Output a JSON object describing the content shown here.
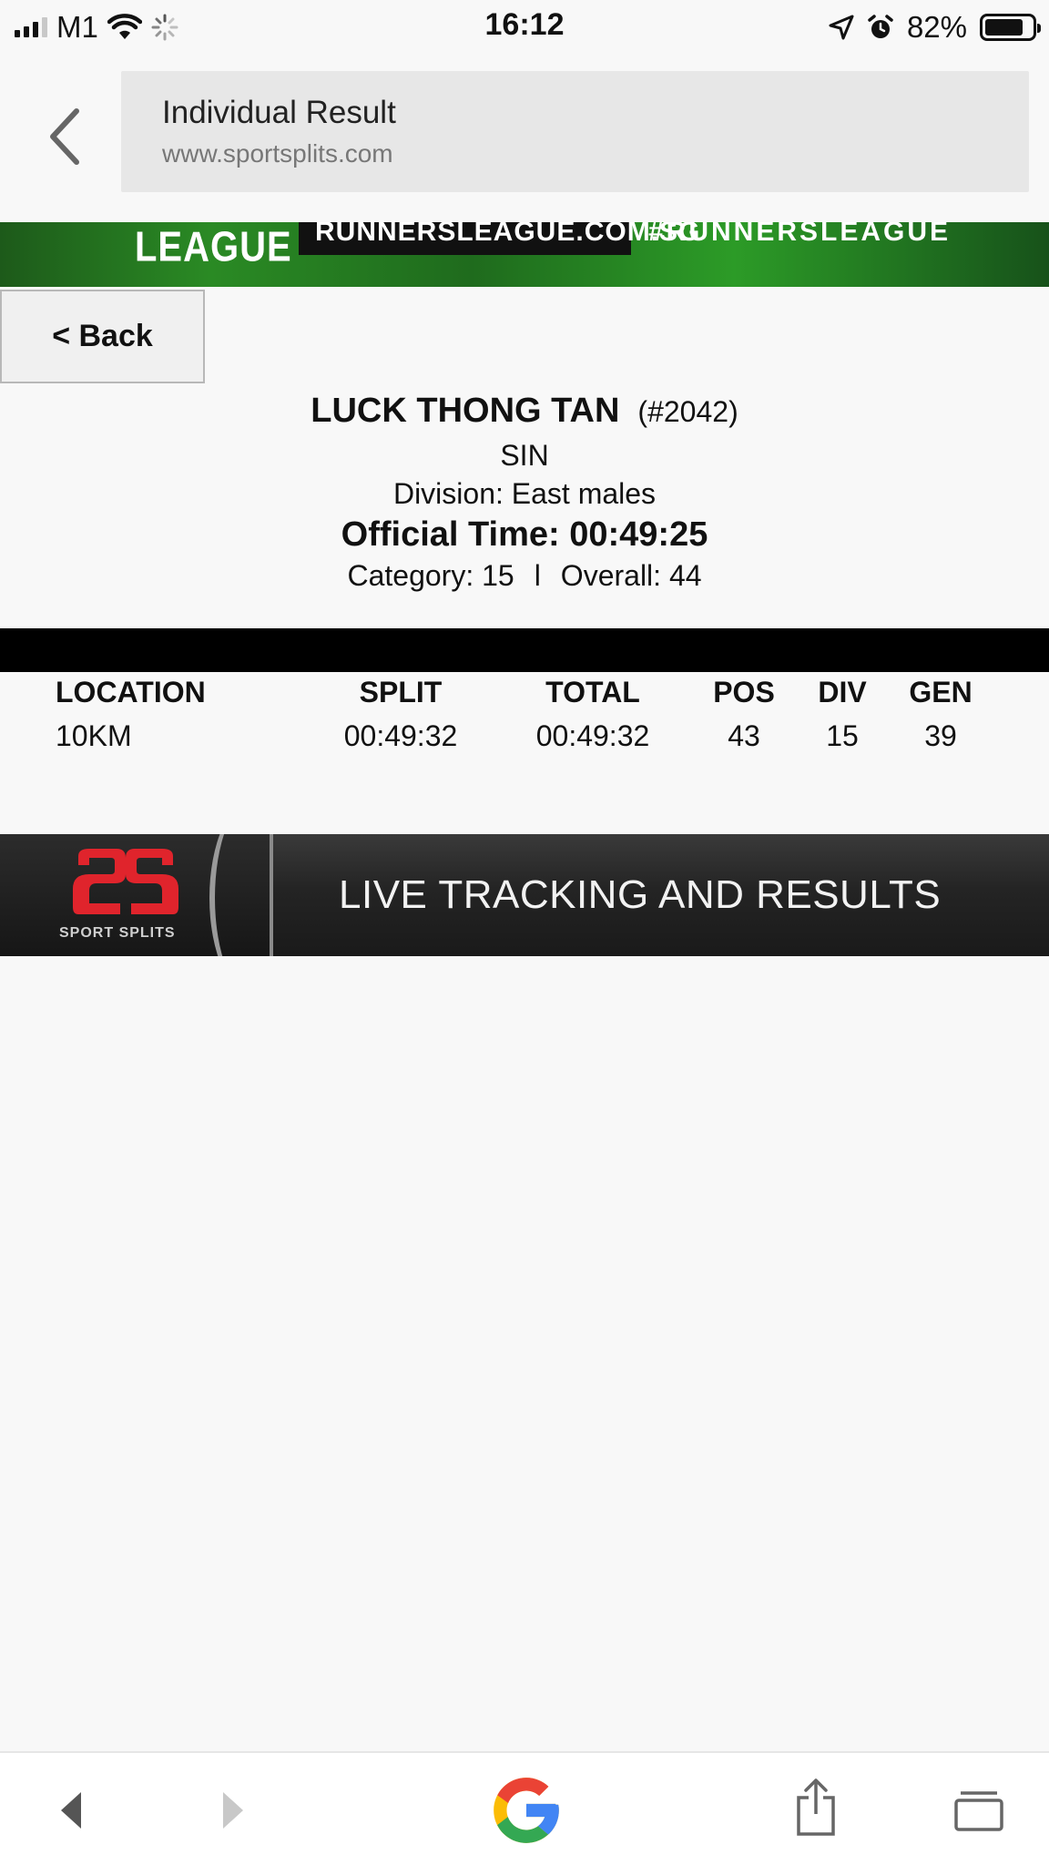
{
  "status_bar": {
    "carrier": "M1",
    "time": "16:12",
    "battery": "82%",
    "battery_level": 0.82
  },
  "browser": {
    "page_title": "Individual Result",
    "domain": "www.sportsplits.com"
  },
  "top_banner": {
    "league_text": "LEAGUE",
    "url_text": "RUNNERSLEAGUE.COM.SG",
    "hashtag_text": "#RUNNERSLEAGUE"
  },
  "back_button_label": "< Back",
  "athlete": {
    "name": "LUCK THONG TAN",
    "bib": "(#2042)",
    "country": "SIN",
    "division": "Division: East males",
    "official_time": "Official Time: 00:49:25",
    "category": "Category: 15",
    "separator": "l",
    "overall": "Overall: 44"
  },
  "splits": {
    "headers": {
      "location": "LOCATION",
      "split": "SPLIT",
      "total": "TOTAL",
      "pos": "POS",
      "div": "DIV",
      "gen": "GEN"
    },
    "rows": [
      {
        "location": "10KM",
        "split": "00:49:32",
        "total": "00:49:32",
        "pos": "43",
        "div": "15",
        "gen": "39"
      }
    ]
  },
  "footer_banner": {
    "logo_text": "SPORT SPLITS",
    "title": "LIVE TRACKING AND RESULTS"
  },
  "colors": {
    "banner_green": "#2a8a24",
    "logo_red": "#e0242c",
    "google_blue": "#4285F4",
    "google_red": "#EA4335",
    "google_yellow": "#FBBC05",
    "google_green": "#34A853"
  },
  "icons": {
    "nav_back": "chevron-left-icon",
    "toolbar": [
      "back-arrow-icon",
      "forward-arrow-icon",
      "google-logo-icon",
      "share-icon",
      "tabs-icon"
    ]
  }
}
